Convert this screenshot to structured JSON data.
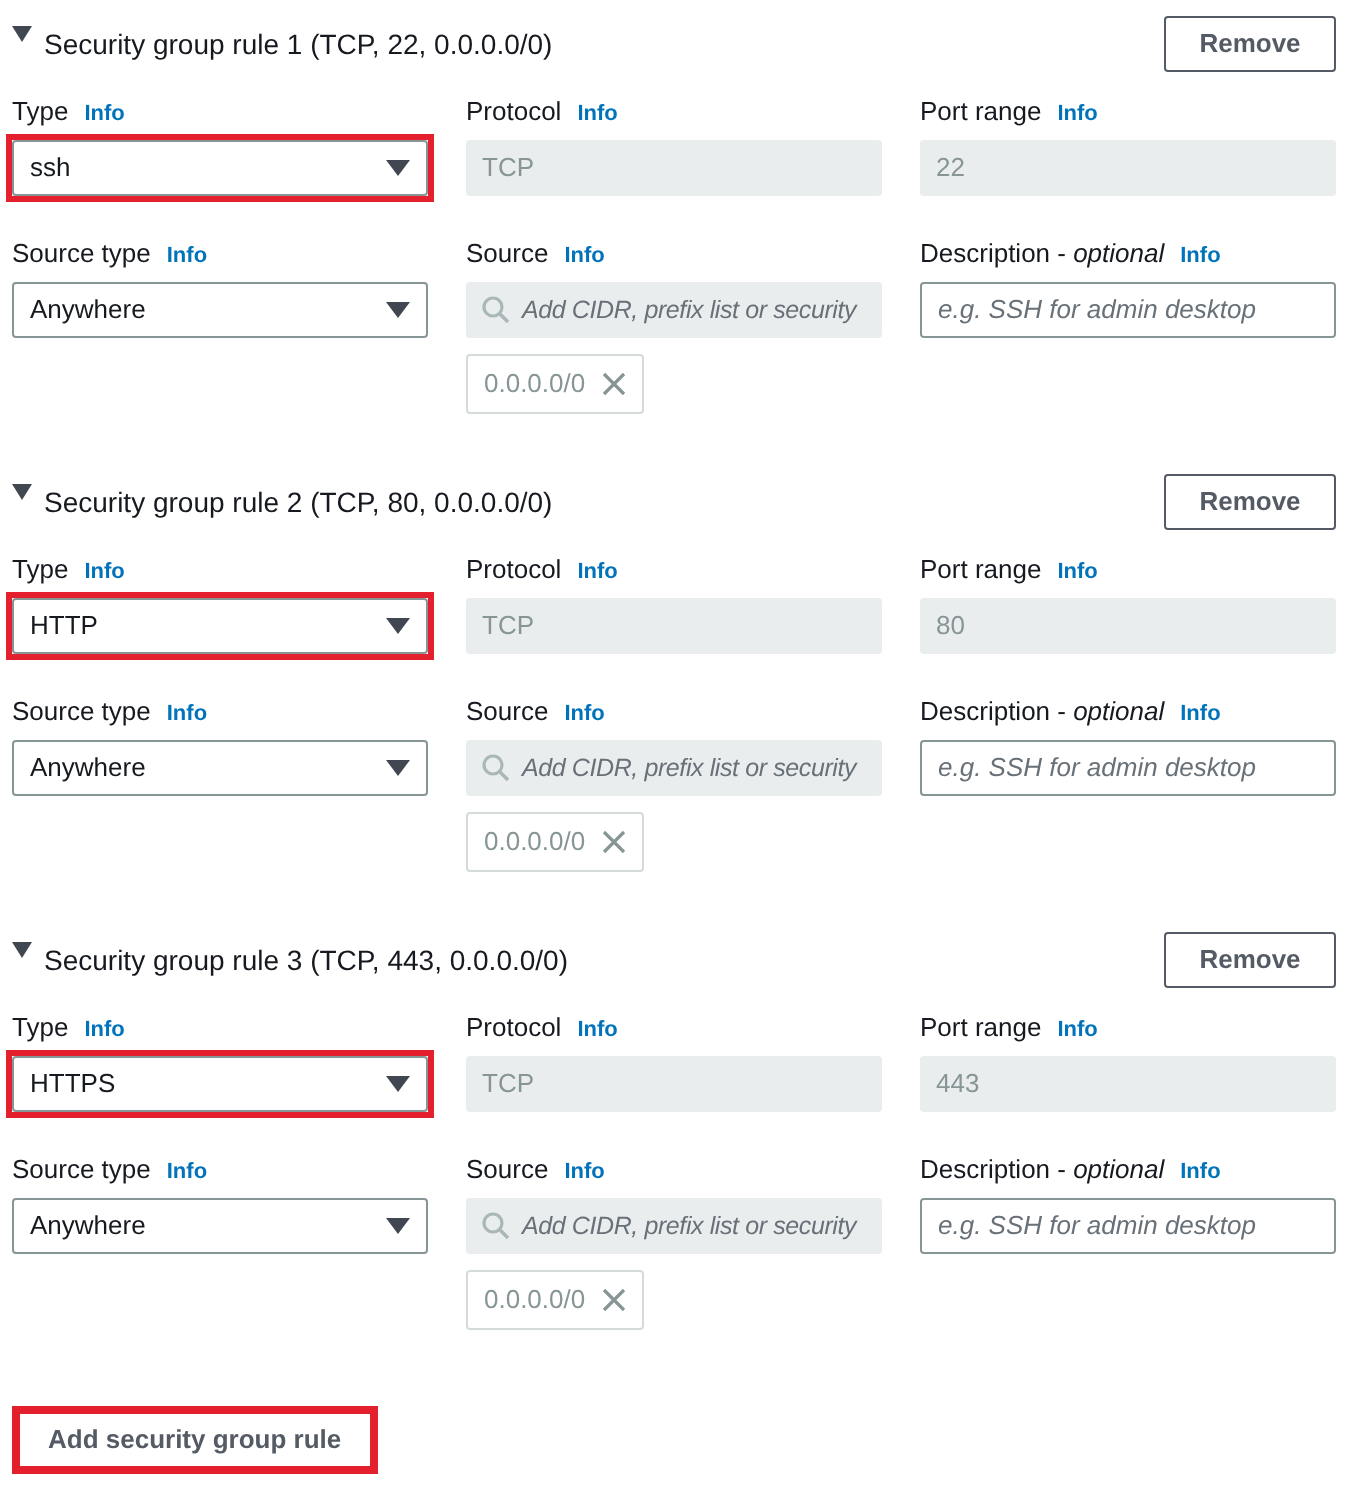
{
  "rules": [
    {
      "title": "Security group rule 1 (TCP, 22, 0.0.0.0/0)",
      "expanded": true,
      "remove": "Remove",
      "type": {
        "label": "Type",
        "info": "Info",
        "value": "ssh",
        "highlighted": true
      },
      "protocol": {
        "label": "Protocol",
        "info": "Info",
        "value": "TCP"
      },
      "port_range": {
        "label": "Port range",
        "info": "Info",
        "value": "22"
      },
      "source_type": {
        "label": "Source type",
        "info": "Info",
        "value": "Anywhere"
      },
      "source": {
        "label": "Source",
        "info": "Info",
        "placeholder": "Add CIDR, prefix list or security",
        "chips": [
          "0.0.0.0/0"
        ]
      },
      "description": {
        "label": "Description - *optional*",
        "info": "Info",
        "placeholder": "e.g. SSH for admin desktop"
      }
    },
    {
      "title": "Security group rule 2 (TCP, 80, 0.0.0.0/0)",
      "expanded": true,
      "remove": "Remove",
      "type": {
        "label": "Type",
        "info": "Info",
        "value": "HTTP",
        "highlighted": true
      },
      "protocol": {
        "label": "Protocol",
        "info": "Info",
        "value": "TCP"
      },
      "port_range": {
        "label": "Port range",
        "info": "Info",
        "value": "80"
      },
      "source_type": {
        "label": "Source type",
        "info": "Info",
        "value": "Anywhere"
      },
      "source": {
        "label": "Source",
        "info": "Info",
        "placeholder": "Add CIDR, prefix list or security",
        "chips": [
          "0.0.0.0/0"
        ]
      },
      "description": {
        "label": "Description - *optional*",
        "info": "Info",
        "placeholder": "e.g. SSH for admin desktop"
      }
    },
    {
      "title": "Security group rule 3 (TCP, 443, 0.0.0.0/0)",
      "expanded": true,
      "remove": "Remove",
      "type": {
        "label": "Type",
        "info": "Info",
        "value": "HTTPS",
        "highlighted": true
      },
      "protocol": {
        "label": "Protocol",
        "info": "Info",
        "value": "TCP"
      },
      "port_range": {
        "label": "Port range",
        "info": "Info",
        "value": "443"
      },
      "source_type": {
        "label": "Source type",
        "info": "Info",
        "value": "Anywhere"
      },
      "source": {
        "label": "Source",
        "info": "Info",
        "placeholder": "Add CIDR, prefix list or security",
        "chips": [
          "0.0.0.0/0"
        ]
      },
      "description": {
        "label": "Description - *optional*",
        "info": "Info",
        "placeholder": "e.g. SSH for admin desktop"
      }
    }
  ],
  "add_button": {
    "label": "Add security group rule",
    "highlighted": true
  }
}
